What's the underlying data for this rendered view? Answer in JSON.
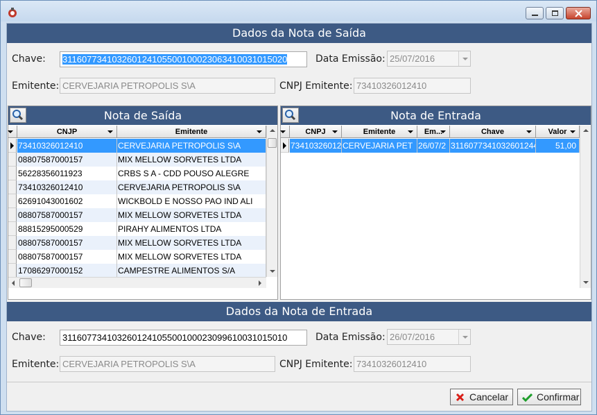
{
  "window": {
    "icon": "app-icon"
  },
  "saida": {
    "header": "Dados da Nota de Saída",
    "chave_label": "Chave:",
    "chave_value": "311607734103260124105500100023063410031015020",
    "data_label": "Data Emissão:",
    "data_value": "25/07/2016",
    "emitente_label": "Emitente:",
    "emitente_value": "CERVEJARIA PETROPOLIS S\\A",
    "cnpj_label": "CNPJ Emitente:",
    "cnpj_value": "73410326012410"
  },
  "left_panel": {
    "title": "Nota de Saída",
    "columns": [
      "CNJP",
      "Emitente"
    ],
    "rows": [
      [
        "73410326012410",
        "CERVEJARIA PETROPOLIS S\\A"
      ],
      [
        "08807587000157",
        "MIX MELLOW SORVETES LTDA"
      ],
      [
        "56228356011923",
        "CRBS S A - CDD POUSO ALEGRE"
      ],
      [
        "73410326012410",
        "CERVEJARIA PETROPOLIS S\\A"
      ],
      [
        "62691043001602",
        "WICKBOLD E NOSSO PAO IND ALI"
      ],
      [
        "08807587000157",
        "MIX MELLOW SORVETES LTDA"
      ],
      [
        "88815295000529",
        "PIRAHY ALIMENTOS LTDA"
      ],
      [
        "08807587000157",
        "MIX MELLOW SORVETES LTDA"
      ],
      [
        "08807587000157",
        "MIX MELLOW SORVETES LTDA"
      ],
      [
        "17086297000152",
        "CAMPESTRE ALIMENTOS S/A"
      ]
    ]
  },
  "right_panel": {
    "title": "Nota de Entrada",
    "columns": [
      "CNPJ",
      "Emitente",
      "Em...",
      "Chave",
      "Valor"
    ],
    "rows": [
      [
        "73410326012",
        "CERVEJARIA PET",
        "26/07/2",
        "3116077341032601244",
        "51,00"
      ]
    ]
  },
  "entrada": {
    "header": "Dados da Nota de Entrada",
    "chave_label": "Chave:",
    "chave_value": "311607734103260124105500100023099610031015010",
    "data_label": "Data Emissão:",
    "data_value": "26/07/2016",
    "emitente_label": "Emitente:",
    "emitente_value": "CERVEJARIA PETROPOLIS S\\A",
    "cnpj_label": "CNPJ Emitente:",
    "cnpj_value": "73410326012410"
  },
  "buttons": {
    "cancel": "Cancelar",
    "confirm": "Confirmar"
  },
  "colors": {
    "header_bg": "#3d5a84",
    "selection": "#3399ff"
  }
}
